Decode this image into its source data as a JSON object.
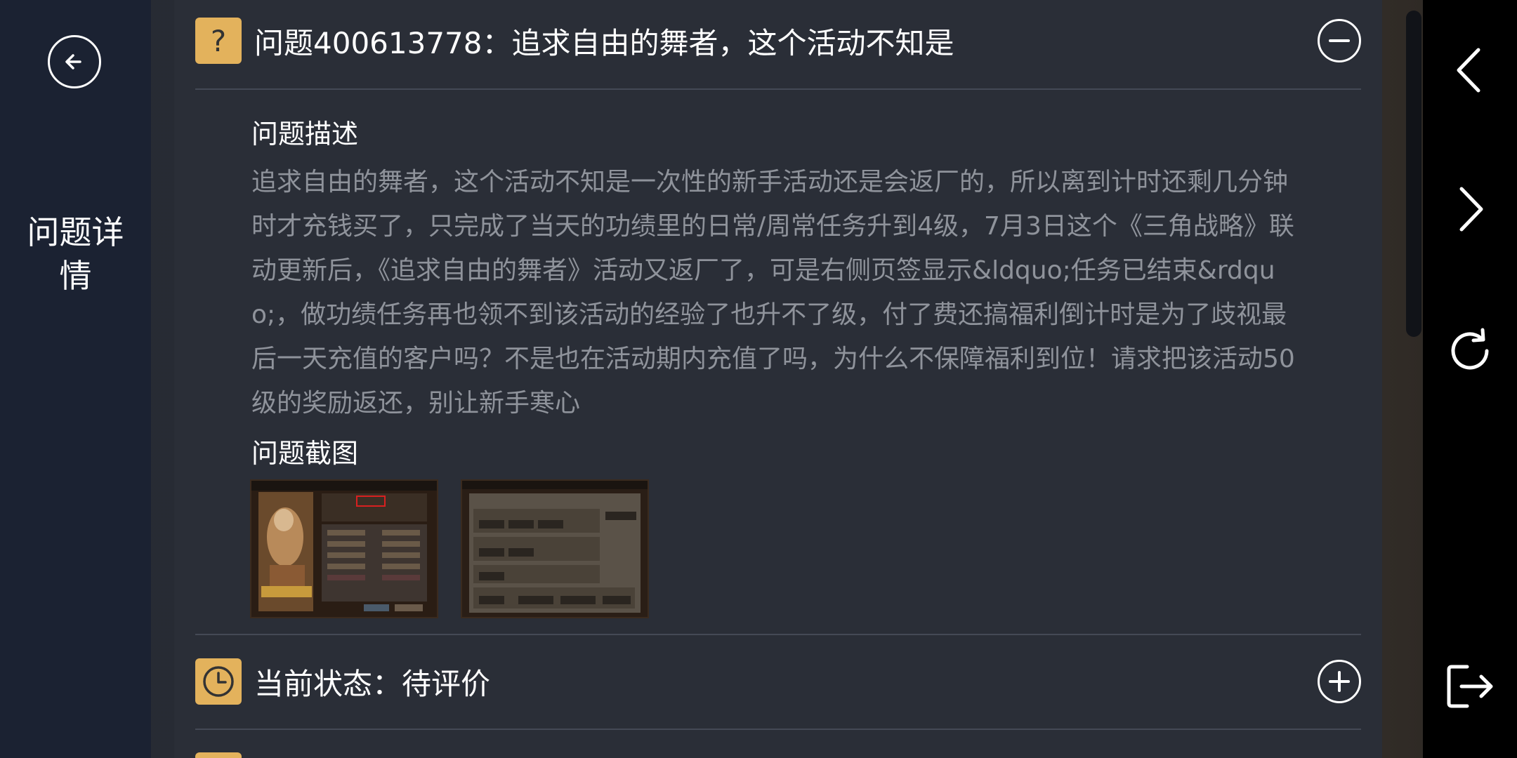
{
  "sidebar": {
    "title": "问题详情"
  },
  "question": {
    "header_title": "问题400613778：追求自由的舞者，这个活动不知是",
    "description_label": "问题描述",
    "description_text": "追求自由的舞者，这个活动不知是一次性的新手活动还是会返厂的，所以离到计时还剩几分钟时才充钱买了，只完成了当天的功绩里的日常/周常任务升到4级，7月3日这个《三角战略》联动更新后，《追求自由的舞者》活动又返厂了，可是右侧页签显示&ldquo;任务已结束&rdquo;，做功绩任务再也领不到该活动的经验了也升不了级，付了费还搞福利倒计时是为了歧视最后一天充值的客户吗？不是也在活动期内充值了吗，为什么不保障福利到位！请求把该活动50级的奖励返还，别让新手寒心",
    "screenshot_label": "问题截图"
  },
  "status": {
    "label": "当前状态：待评价"
  },
  "colors": {
    "accent": "#e3b25c",
    "panel": "#2a2e37",
    "sidebar": "#1b2232",
    "muted_text": "#8f939b"
  }
}
